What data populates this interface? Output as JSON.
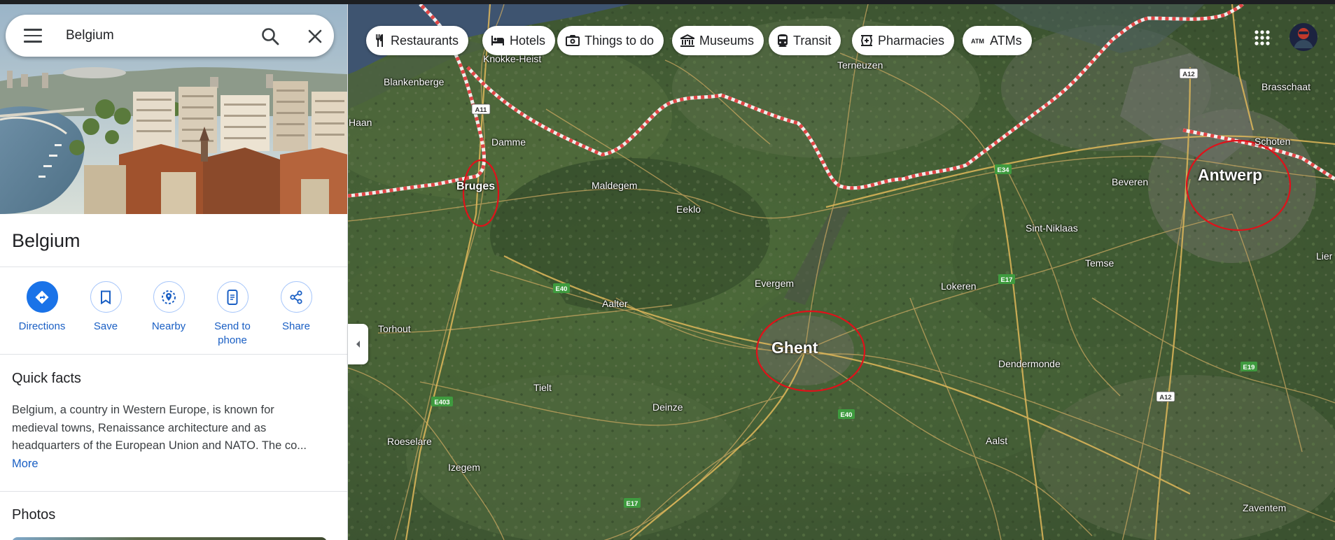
{
  "search": {
    "query": "Belgium"
  },
  "place": {
    "title": "Belgium",
    "actions": [
      {
        "label": "Directions"
      },
      {
        "label": "Save"
      },
      {
        "label": "Nearby"
      },
      {
        "label": "Send to\nphone"
      },
      {
        "label": "Share"
      }
    ],
    "quick_facts": {
      "title": "Quick facts",
      "text": "Belgium, a country in Western Europe, is known for medieval towns, Renaissance architecture and as headquarters of the European Union and NATO. The co...",
      "more": "More"
    },
    "photos_title": "Photos"
  },
  "chips": [
    {
      "label": "Restaurants",
      "icon": "fork-knife-icon"
    },
    {
      "label": "Hotels",
      "icon": "bed-icon"
    },
    {
      "label": "Things to do",
      "icon": "camera-icon"
    },
    {
      "label": "Museums",
      "icon": "museum-icon"
    },
    {
      "label": "Transit",
      "icon": "train-icon"
    },
    {
      "label": "Pharmacies",
      "icon": "pharmacy-icon"
    },
    {
      "label": "ATMs",
      "icon": "atm-icon"
    }
  ],
  "map": {
    "cities": [
      {
        "name": "Bruges"
      },
      {
        "name": "Ghent"
      },
      {
        "name": "Antwerp"
      }
    ],
    "towns": [
      "Knokke-Heist",
      "Blankenberge",
      "Terneuzen",
      "Brasschaat",
      "Haan",
      "Damme",
      "Schoten",
      "Maldegem",
      "Eeklo",
      "Beveren",
      "Sint-Niklaas",
      "Evergem",
      "Temse",
      "Lokeren",
      "Aalter",
      "Torhout",
      "Dendermonde",
      "Tielt",
      "Deinze",
      "Roeselare",
      "Aalst",
      "Izegem",
      "Zaventem",
      "Lier"
    ],
    "road_shields": [
      "A11",
      "A12",
      "E34",
      "E40",
      "E17",
      "E19",
      "E403",
      "A12",
      "E40",
      "E17"
    ]
  },
  "colors": {
    "accent": "#1a73e8",
    "border_line": "#e04545",
    "annotation_circle": "#e0111a"
  }
}
